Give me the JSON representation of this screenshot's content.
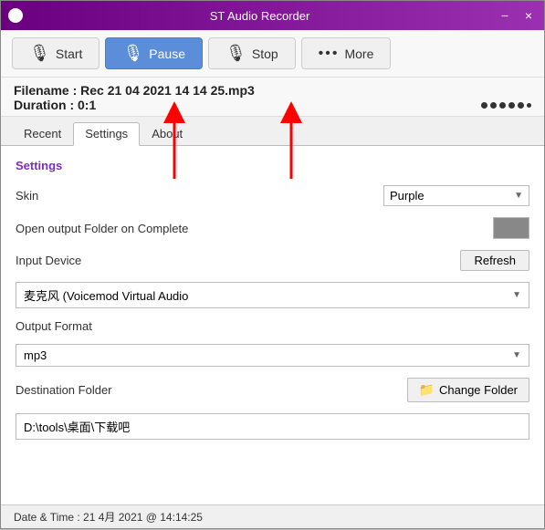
{
  "titleBar": {
    "icon": "app-icon",
    "title": "ST Audio Recorder",
    "minimize": "−",
    "close": "×"
  },
  "toolbar": {
    "startLabel": "Start",
    "pauseLabel": "Pause",
    "stopLabel": "Stop",
    "moreLabel": "More"
  },
  "infoBar": {
    "filename": "Filename : Rec 21 04 2021 14 14 25.mp3",
    "duration": "Duration : 0:1"
  },
  "tabs": [
    {
      "id": "recent",
      "label": "Recent"
    },
    {
      "id": "settings",
      "label": "Settings",
      "active": true
    },
    {
      "id": "about",
      "label": "About"
    }
  ],
  "settings": {
    "sectionTitle": "Settings",
    "skinLabel": "Skin",
    "skinValue": "Purple",
    "openFolderLabel": "Open output Folder on Complete",
    "inputDeviceLabel": "Input Device",
    "refreshLabel": "Refresh",
    "inputDeviceValue": "麦克风 (Voicemod Virtual Audio",
    "outputFormatLabel": "Output Format",
    "outputFormatValue": "mp3",
    "destinationFolderLabel": "Destination Folder",
    "changeFolderLabel": "Change Folder",
    "destinationFolderValue": "D:\\tools\\桌面\\下载吧"
  },
  "statusBar": {
    "text": "Date & Time : 21 4月 2021 @ 14:14:25"
  }
}
